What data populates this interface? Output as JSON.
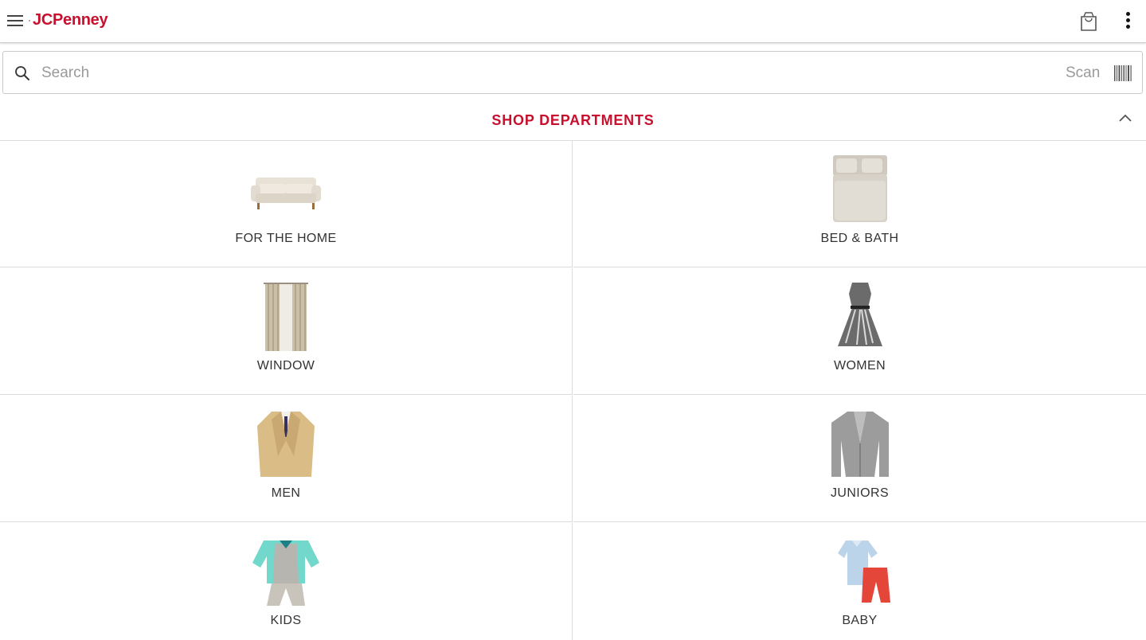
{
  "header": {
    "brand": "JCPenney"
  },
  "search": {
    "placeholder": "Search",
    "scan_label": "Scan"
  },
  "departments": {
    "title": "SHOP DEPARTMENTS",
    "items": [
      {
        "label": "FOR THE HOME"
      },
      {
        "label": "BED & BATH"
      },
      {
        "label": "WINDOW"
      },
      {
        "label": "WOMEN"
      },
      {
        "label": "MEN"
      },
      {
        "label": "JUNIORS"
      },
      {
        "label": "KIDS"
      },
      {
        "label": "BABY"
      }
    ]
  },
  "colors": {
    "brand_red": "#c8102e"
  },
  "icons": [
    "menu-icon",
    "shopping-bag-icon",
    "more-vert-icon",
    "search-icon",
    "barcode-icon",
    "chevron-up-icon"
  ]
}
